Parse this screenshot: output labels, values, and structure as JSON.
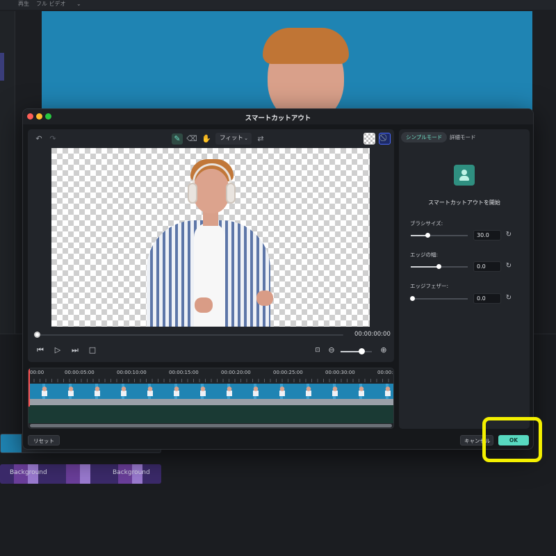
{
  "background": {
    "menu_items": [
      "再生",
      "フル ビデオ"
    ],
    "track_label": "Background"
  },
  "dialog": {
    "title": "スマートカットアウト",
    "toolbar": {
      "undo_icon": "undo-icon",
      "redo_icon": "redo-icon",
      "brush_icon": "brush-icon",
      "eraser_icon": "eraser-icon",
      "hand_icon": "hand-icon",
      "zoom_mode": "フィット",
      "swap_icon": "swap-icon"
    },
    "preview": {
      "timecode": "00:00:00:00"
    },
    "timeline": {
      "ticks": [
        "00:00",
        "00:00:05:00",
        "00:00:10:00",
        "00:00:15:00",
        "00:00:20:00",
        "00:00:25:00",
        "00:00:30:00",
        "00:00:3"
      ]
    },
    "panel": {
      "tabs": [
        "シンプルモード",
        "詳細モード"
      ],
      "active_tab": 0,
      "start_label": "スマートカットアウトを開始",
      "params": [
        {
          "label": "ブラシサイズ:",
          "value": "30.0",
          "level": 0.3
        },
        {
          "label": "エッジの幅:",
          "value": "0.0",
          "level": 0.5
        },
        {
          "label": "エッジフェザー:",
          "value": "0.0",
          "level": 0.0
        }
      ]
    },
    "footer": {
      "reset_label": "リセット",
      "cancel_label": "キャンセル",
      "ok_label": "OK"
    }
  },
  "colors": {
    "accent": "#58d9c0",
    "highlight": "#f4f000"
  }
}
